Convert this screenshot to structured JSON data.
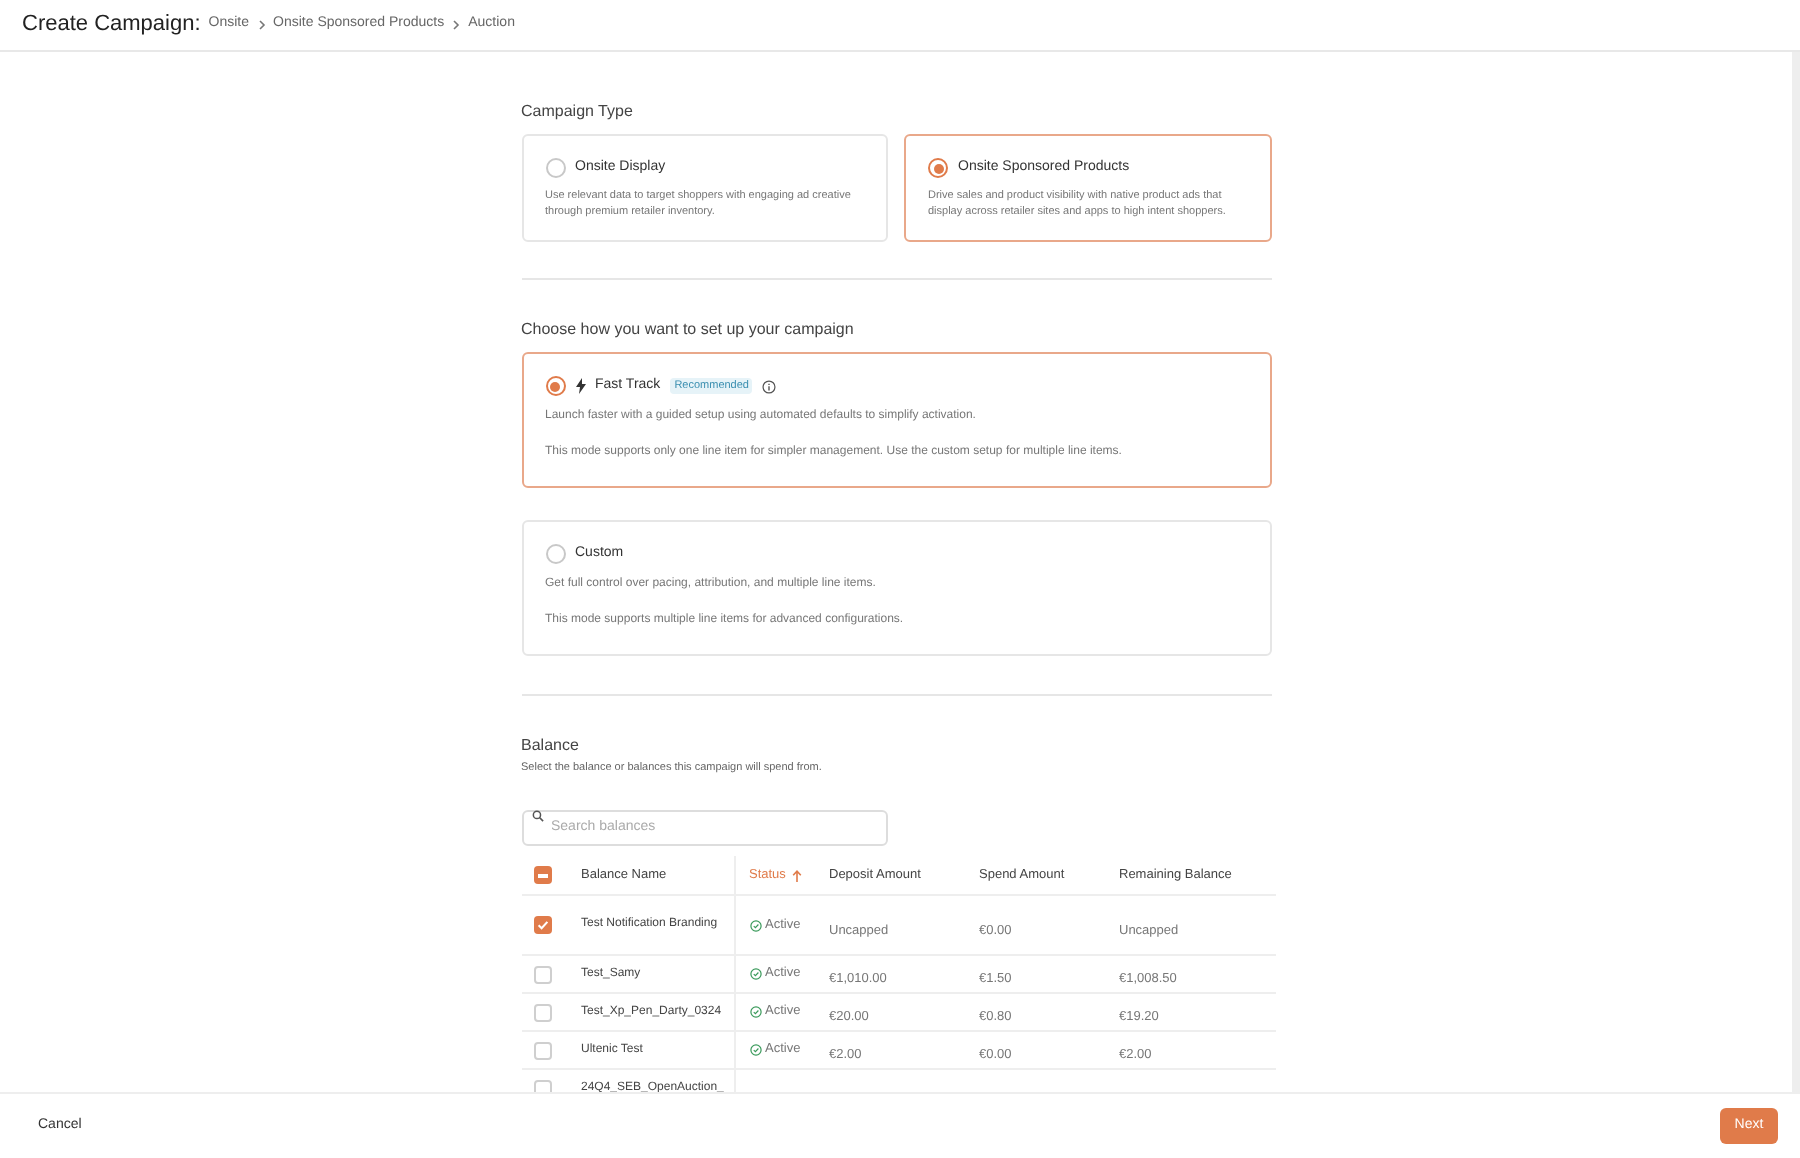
{
  "header": {
    "title": "Create Campaign:",
    "breadcrumb": [
      "Onsite",
      "Onsite Sponsored Products",
      "Auction"
    ]
  },
  "campaign_type": {
    "label": "Campaign Type",
    "options": [
      {
        "title": "Onsite Display",
        "description": "Use relevant data to target shoppers with engaging ad creative through premium retailer inventory.",
        "selected": false
      },
      {
        "title": "Onsite Sponsored Products",
        "description": "Drive sales and product visibility with native product ads that display across retailer sites and apps to high intent shoppers.",
        "selected": true
      }
    ]
  },
  "setup": {
    "label": "Choose how you want to set up your campaign",
    "options": [
      {
        "kind": "fast",
        "title": "Fast Track",
        "badge": "Recommended",
        "lines": [
          "Launch faster with a guided setup using automated defaults to simplify activation.",
          "This mode supports only one line item for simpler management. Use the custom setup for multiple line items."
        ],
        "selected": true
      },
      {
        "kind": "custom",
        "title": "Custom",
        "lines": [
          "Get full control over pacing, attribution, and multiple line items.",
          "This mode supports multiple line items for advanced configurations."
        ],
        "selected": false
      }
    ]
  },
  "balance": {
    "title": "Balance",
    "subtitle": "Select the balance or balances this campaign will spend from.",
    "search": {
      "placeholder": "Search balances"
    },
    "columns": [
      {
        "label": "Balance Name",
        "sorted": false
      },
      {
        "label": "Status",
        "sorted": true
      },
      {
        "label": "Deposit Amount",
        "sorted": false
      },
      {
        "label": "Spend Amount",
        "sorted": false
      },
      {
        "label": "Remaining Balance",
        "sorted": false
      }
    ],
    "header_checkbox": {
      "checked": true,
      "partial": true
    },
    "rows": [
      {
        "name": "Test Notification Branding",
        "status": "Active",
        "deposit": "Uncapped",
        "spend": "€0.00",
        "remaining": "Uncapped",
        "checked": true
      },
      {
        "name": "Test_Samy",
        "status": "Active",
        "deposit": "€1,010.00",
        "spend": "€1.50",
        "remaining": "€1,008.50",
        "checked": false
      },
      {
        "name": "Test_Xp_Pen_Darty_0324",
        "status": "Active",
        "deposit": "€20.00",
        "spend": "€0.80",
        "remaining": "€19.20",
        "checked": false
      },
      {
        "name": "Ultenic Test",
        "status": "Active",
        "deposit": "€2.00",
        "spend": "€0.00",
        "remaining": "€2.00",
        "checked": false
      },
      {
        "name": "24Q4_SEB_OpenAuction_",
        "checked": false
      }
    ]
  },
  "footer": {
    "cancel": "Cancel",
    "next": "Next"
  }
}
